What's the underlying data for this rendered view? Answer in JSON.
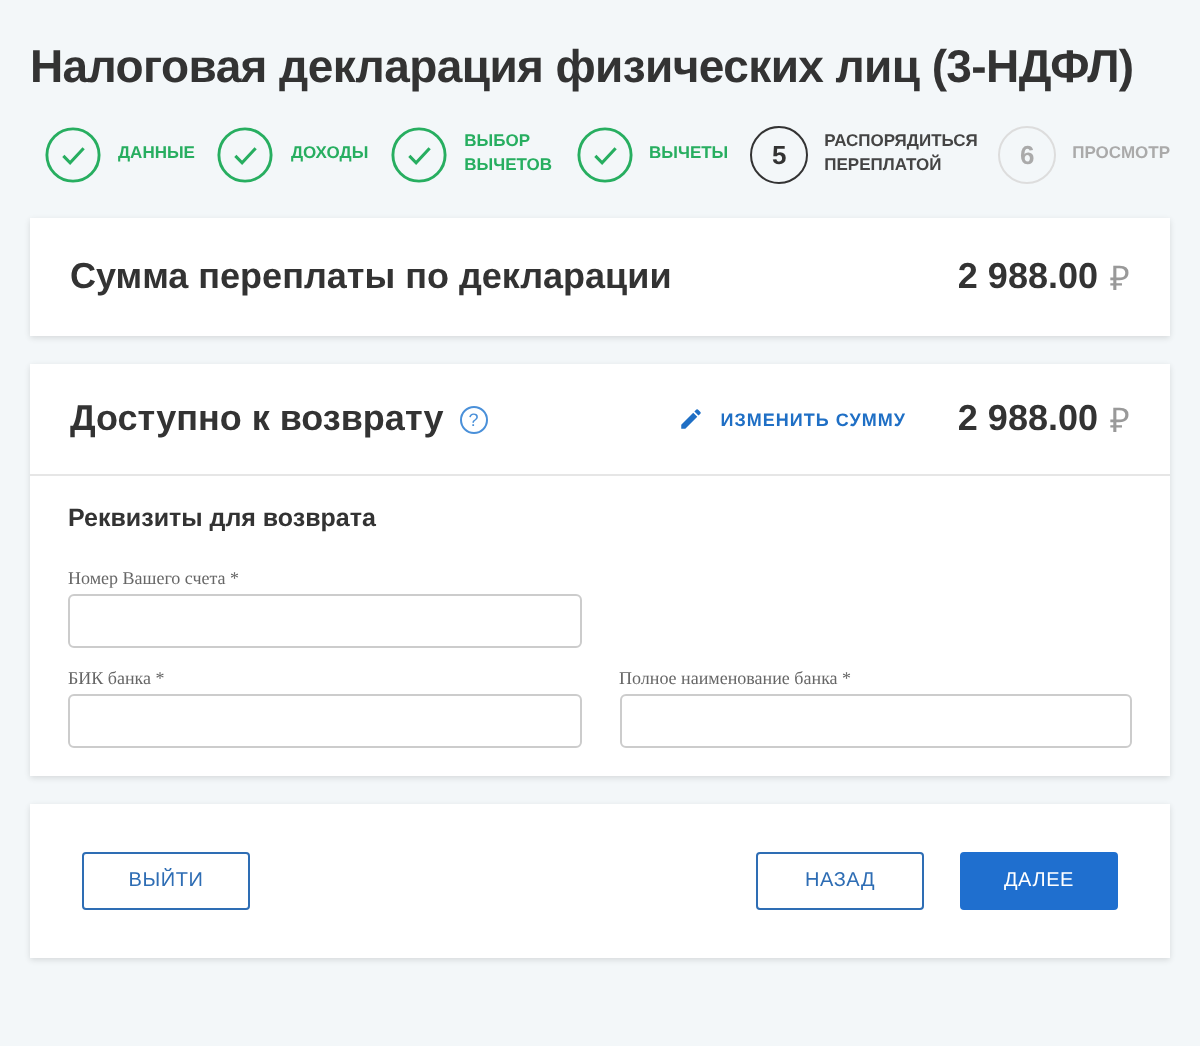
{
  "title": "Налоговая декларация физических лиц (3-НДФЛ)",
  "steps": [
    {
      "kind": "done",
      "label": "ДАННЫЕ"
    },
    {
      "kind": "done",
      "label": "ДОХОДЫ"
    },
    {
      "kind": "done",
      "label": "ВЫБОР ВЫЧЕТОВ"
    },
    {
      "kind": "done",
      "label": "ВЫЧЕТЫ"
    },
    {
      "kind": "current",
      "number": "5",
      "label": "РАСПОРЯДИТЬСЯ ПЕРЕПЛАТОЙ"
    },
    {
      "kind": "pending",
      "number": "6",
      "label": "ПРОСМОТР"
    }
  ],
  "overpayment": {
    "label": "Сумма переплаты по декларации",
    "amount": "2 988.00",
    "currency": "₽"
  },
  "refund": {
    "label": "Доступно к возврату",
    "help": "?",
    "edit_link": "ИЗМЕНИТЬ СУММУ",
    "amount": "2 988.00",
    "currency": "₽",
    "section_title": "Реквизиты для возврата",
    "fields": [
      {
        "label": "Номер Вашего счета *"
      },
      {
        "label": "БИК банка *"
      },
      {
        "label": "Полное наименование банка *"
      }
    ]
  },
  "buttons": [
    {
      "kind": "outline",
      "label": "ВЫЙТИ"
    },
    {
      "kind": "outline",
      "label": "НАЗАД"
    },
    {
      "kind": "primary",
      "label": "ДАЛЕЕ"
    }
  ]
}
